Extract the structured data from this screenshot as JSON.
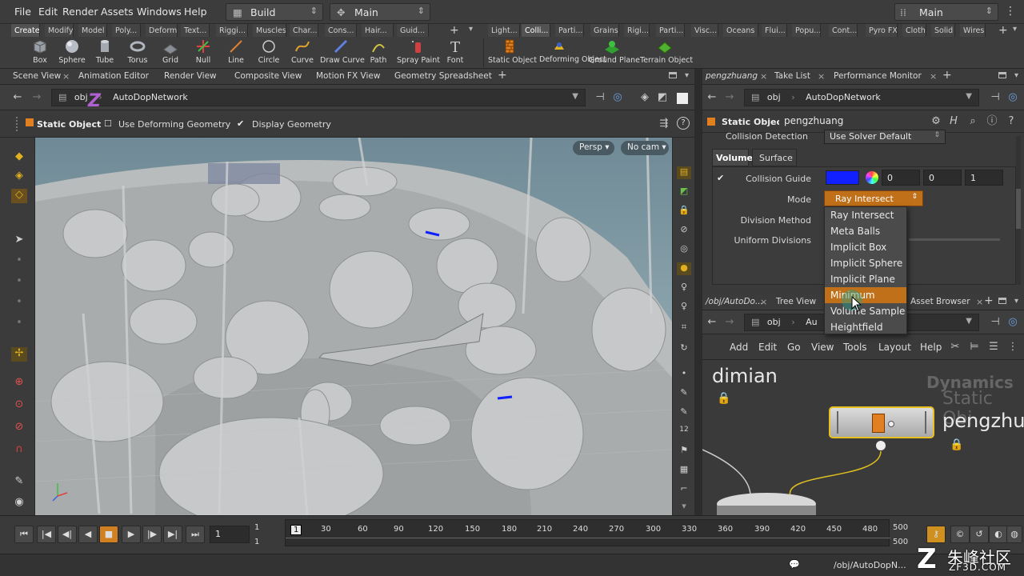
{
  "menubar": {
    "items": [
      "File",
      "Edit",
      "Render",
      "Assets",
      "Windows",
      "Help"
    ],
    "desktop": "Build",
    "context": "Main",
    "right_context": "Main"
  },
  "shelf": {
    "tabs_left": [
      "Create",
      "Modify",
      "Model",
      "Poly...",
      "Deform",
      "Text...",
      "Riggi...",
      "Muscles",
      "Char...",
      "Cons...",
      "Hair...",
      "Guid..."
    ],
    "tabs_right": [
      "Light...",
      "Colli...",
      "Parti...",
      "Grains",
      "Rigi...",
      "Parti...",
      "Visc...",
      "Oceans",
      "Flui...",
      "Popu...",
      "Cont...",
      "Pyro FX",
      "Cloth",
      "Solid",
      "Wires"
    ],
    "tools_left": [
      "Box",
      "Sphere",
      "Tube",
      "Torus",
      "Grid",
      "Null",
      "Line",
      "Circle",
      "Curve",
      "Draw Curve",
      "Path",
      "Spray Paint",
      "Font"
    ],
    "tools_right": [
      "Static Object",
      "Deforming Object",
      "Ground Plane",
      "Terrain Object"
    ]
  },
  "scene_pane": {
    "tabs": [
      "Scene View",
      "Animation Editor",
      "Render View",
      "Composite View",
      "Motion FX View",
      "Geometry Spreadsheet"
    ],
    "path_root": "obj",
    "path_node": "AutoDopNetwork",
    "op_title": "Static Object",
    "option1": "Use Deforming Geometry",
    "option2": "Display Geometry",
    "camera_menu": "Persp",
    "cam_menu2": "No cam",
    "logo_letter": "Z"
  },
  "params_pane": {
    "tabs": [
      "pengzhuang",
      "Take List",
      "Performance Monitor"
    ],
    "path_root": "obj",
    "path_node": "AutoDopNetwork",
    "node_type": "Static Object",
    "node_name": "pengzhuang",
    "collision_detection_label": "Collision Detection",
    "collision_detection_value": "Use Solver Default",
    "subtabs": [
      "Volume",
      "Surface"
    ],
    "collision_guide_label": "Collision Guide",
    "collision_guide_color": "#1020ff",
    "guide_values": [
      "0",
      "0",
      "1"
    ],
    "mode_label": "Mode",
    "mode_value": "Ray Intersect",
    "division_method_label": "Division Method",
    "uniform_divisions_label": "Uniform Divisions"
  },
  "mode_dropdown": {
    "options": [
      "Ray Intersect",
      "Meta Balls",
      "Implicit Box",
      "Implicit Sphere",
      "Implicit Plane",
      "Minimum",
      "Volume Sample",
      "Heightfield"
    ],
    "highlighted": "Minimum"
  },
  "network_pane": {
    "tabs": [
      "/obj/AutoDo...",
      "Tree View",
      "Asset Browser"
    ],
    "path_root": "obj",
    "path_node": "Au",
    "menu": [
      "Add",
      "Edit",
      "Go",
      "View",
      "Tools",
      "Layout",
      "Help"
    ],
    "left_node_label": "dimian",
    "context_label": "Dynamics",
    "node_type_label": "Static Obj",
    "node_name_label": "pengzhu"
  },
  "timeline": {
    "current_frame": "1",
    "start_frame": "1",
    "start_frame2": "1",
    "ticks": [
      "1",
      "30",
      "60",
      "90",
      "120",
      "150",
      "180",
      "210",
      "240",
      "270",
      "300",
      "330",
      "360",
      "390",
      "420",
      "450",
      "480"
    ],
    "end_frame": "500",
    "end_frame2": "500"
  },
  "statusbar": {
    "path": "/obj/AutoDopN...",
    "watermark": "朱峰社区",
    "watermark_url": "ZF3D.COM"
  },
  "colors": {
    "accent_orange": "#c07018",
    "selection_yellow": "#e8c020",
    "collision_blue": "#1020ff"
  }
}
